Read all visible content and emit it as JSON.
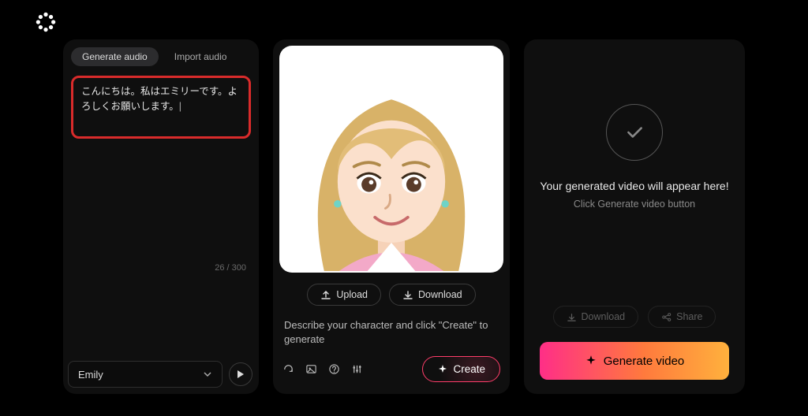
{
  "tabs": {
    "generate": "Generate audio",
    "import": "Import audio"
  },
  "script": {
    "text": "こんにちは。私はエミリーです。よろしくお願いします。",
    "counter": "26 / 300"
  },
  "voice": {
    "selected": "Emily"
  },
  "avatar": {
    "upload_label": "Upload",
    "download_label": "Download",
    "describe_hint": "Describe your character and click \"Create\" to generate",
    "create_label": "Create"
  },
  "output": {
    "title": "Your generated video will appear here!",
    "subtitle": "Click Generate video button",
    "download_label": "Download",
    "share_label": "Share",
    "generate_label": "Generate video"
  }
}
